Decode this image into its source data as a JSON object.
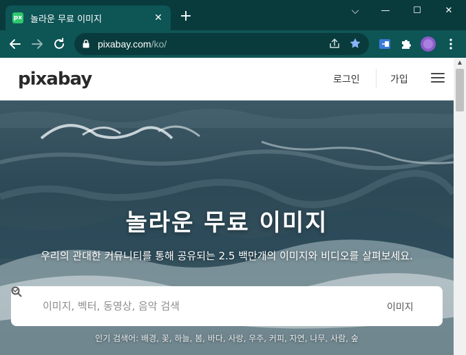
{
  "browser": {
    "tab": {
      "favicon_text": "px",
      "title": "놀라운 무료 이미지",
      "close_glyph": "✕"
    },
    "new_tab_glyph": "+",
    "window_controls": {
      "dropdown": "⌵",
      "minimize": "—",
      "maximize": "☐",
      "close": "✕"
    },
    "url_host": "pixabay.com",
    "url_path": "/ko/",
    "icons": [
      "back-icon",
      "forward-icon",
      "reload-icon",
      "lock-icon",
      "share-icon",
      "star-icon",
      "extension-icon",
      "puzzle-icon",
      "profile-avatar",
      "more-icon"
    ]
  },
  "header": {
    "logo": "pixabay",
    "login": "로그인",
    "signup": "가입"
  },
  "hero": {
    "title": "놀라운 무료 이미지",
    "subtitle": "우리의 관대한 커뮤니티를 통해 공유되는 2.5 백만개의 이미지와 비디오를 살펴보세요."
  },
  "search": {
    "placeholder": "이미지, 벡터, 동영상, 음악 검색",
    "type": "이미지"
  },
  "popular": {
    "text": "인기 검색어: 배경, 꽃, 하늘, 봄, 바다, 사랑, 우주, 커피, 자연, 나무, 사람, 숲"
  },
  "colors": {
    "chrome_dark": "#0a3b3c",
    "chrome": "#0e5556",
    "star": "#8ab4f8",
    "brand_green": "#2ec66d"
  }
}
